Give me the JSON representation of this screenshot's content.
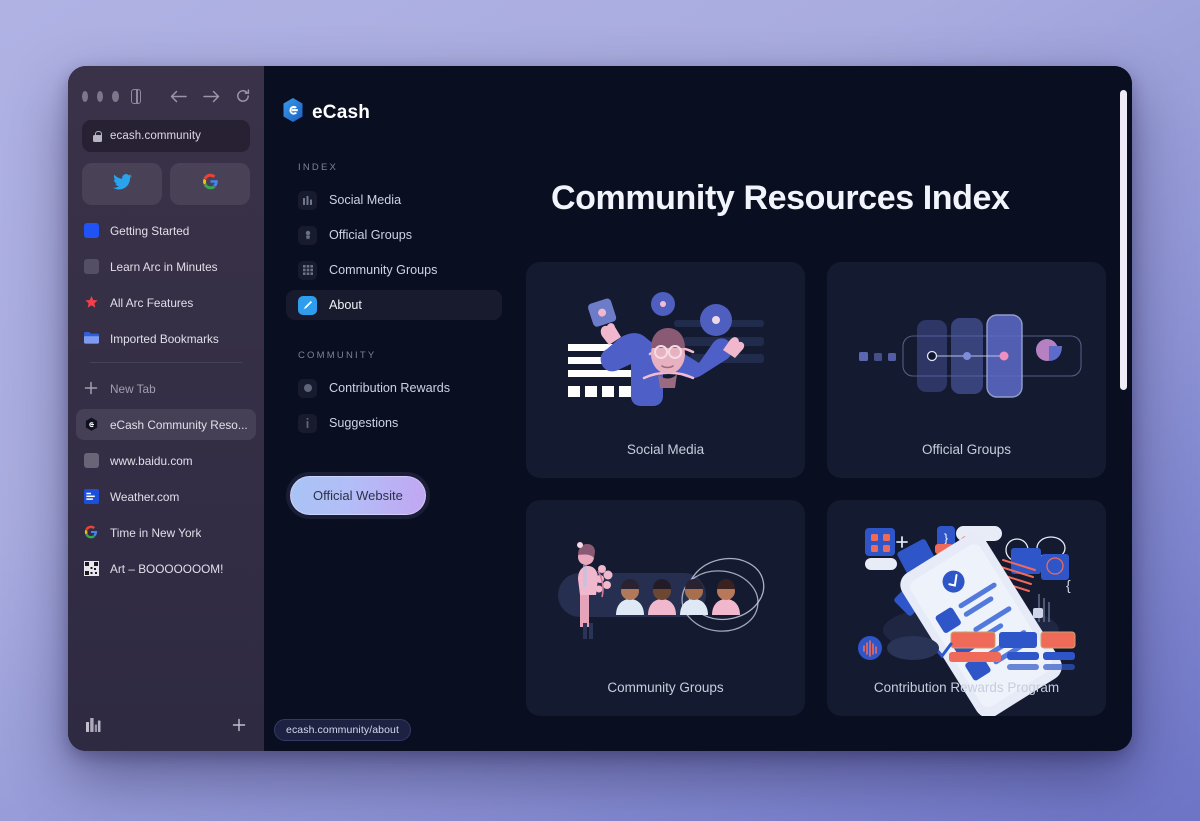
{
  "browser": {
    "url_value": "ecash.community",
    "lock_icon": "lock-icon",
    "back_icon": "back-arrow-icon",
    "forward_icon": "forward-arrow-icon",
    "reload_icon": "reload-icon",
    "split_view_icon": "sidebar-toggle-icon",
    "quick_links": [
      {
        "name": "twitter-shortcut",
        "icon": "twitter-icon"
      },
      {
        "name": "google-shortcut",
        "icon": "google-icon"
      }
    ],
    "pinned": [
      {
        "label": "Getting Started",
        "icon": "blue-square-icon"
      },
      {
        "label": "Learn Arc in Minutes",
        "icon": "arc-learn-icon"
      },
      {
        "label": "All Arc Features",
        "icon": "red-star-icon"
      },
      {
        "label": "Imported Bookmarks",
        "icon": "folder-icon"
      }
    ],
    "new_tab_label": "New Tab",
    "new_tab_icon": "plus-icon",
    "tabs": [
      {
        "label": "eCash Community Reso...",
        "icon": "ecash-favicon",
        "active": true
      },
      {
        "label": "www.baidu.com",
        "icon": "blank-favicon",
        "active": false
      },
      {
        "label": "Weather.com",
        "icon": "weather-favicon",
        "active": false
      },
      {
        "label": "Time in New York",
        "icon": "google-favicon",
        "active": false
      },
      {
        "label": "Art – BOOOOOOOM!",
        "icon": "art-favicon",
        "active": false
      }
    ],
    "footer": {
      "library_icon": "library-chart-icon",
      "add_icon": "plus-icon"
    }
  },
  "site": {
    "brand_name": "eCash",
    "brand_icon": "ecash-hex-logo",
    "toc": {
      "index_heading": "INDEX",
      "index_items": [
        {
          "label": "Social Media",
          "icon": "grid-small-icon",
          "active": false
        },
        {
          "label": "Official Groups",
          "icon": "badge-icon",
          "active": false
        },
        {
          "label": "Community Groups",
          "icon": "grid-icon",
          "active": false
        },
        {
          "label": "About",
          "icon": "pencil-icon",
          "active": true
        }
      ],
      "community_heading": "COMMUNITY",
      "community_items": [
        {
          "label": "Contribution Rewards",
          "icon": "circle-icon",
          "active": false
        },
        {
          "label": "Suggestions",
          "icon": "info-icon",
          "active": false
        }
      ]
    },
    "official_website_button": "Official Website",
    "status_url": "ecash.community/about",
    "page_title": "Community Resources Index",
    "cards": [
      {
        "caption": "Social Media",
        "art": "juggling-person-illustration"
      },
      {
        "caption": "Official Groups",
        "art": "connected-cards-illustration"
      },
      {
        "caption": "Community Groups",
        "art": "people-row-illustration"
      },
      {
        "caption": "Contribution Rewards Program",
        "art": "isometric-phone-illustration"
      }
    ]
  },
  "colors": {
    "accent_blue": "#2f9ded",
    "page_bg": "#0a0e21",
    "card_bg": "#141a30",
    "sidebar_bg": "#352f46",
    "button_gradient_start": "#a9c4f5",
    "button_gradient_end": "#c1a6f2"
  }
}
